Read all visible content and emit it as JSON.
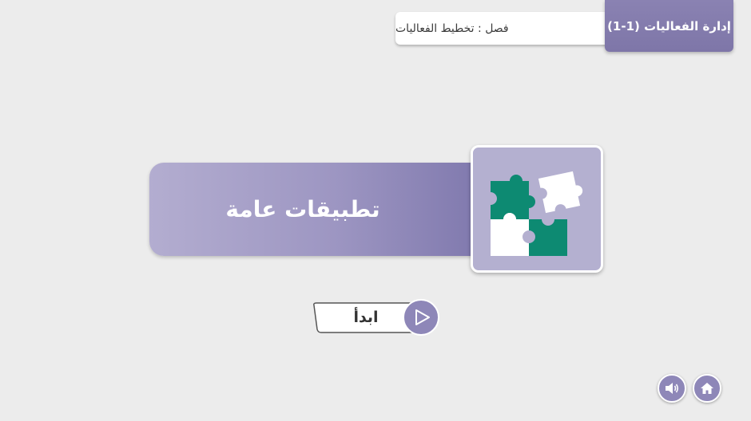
{
  "header": {
    "course_title": "إدارة الفعاليات (1-1)",
    "chapter": "فصل : تخطيط الفعاليات"
  },
  "lesson": {
    "title": "تطبيقات عامة",
    "icon": "puzzle-icon"
  },
  "start_button": {
    "label": "ابدأ",
    "icon": "play-icon"
  },
  "controls": {
    "sound_icon": "speaker-icon",
    "home_icon": "home-icon"
  },
  "colors": {
    "accent": "#8a82b2",
    "puzzle_teal": "#0d8a72",
    "background": "#ececec"
  }
}
